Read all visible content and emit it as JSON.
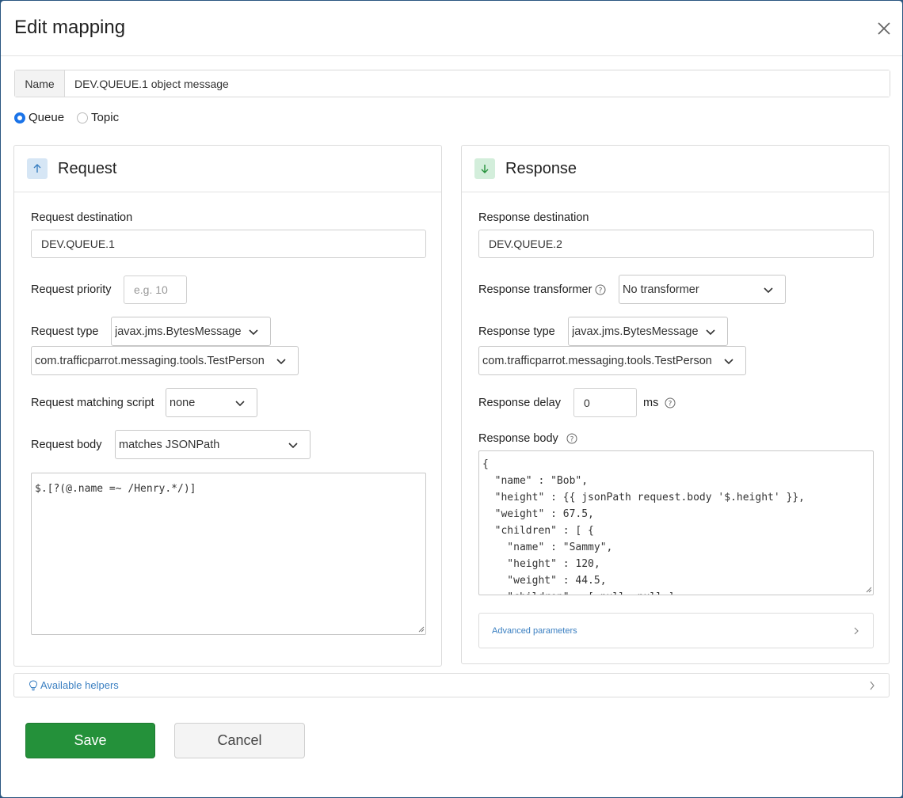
{
  "dialog": {
    "title": "Edit mapping"
  },
  "name": {
    "label": "Name",
    "value": "DEV.QUEUE.1 object message"
  },
  "destination_kind": {
    "queue_label": "Queue",
    "topic_label": "Topic",
    "selected": "Queue"
  },
  "request": {
    "title": "Request",
    "destination_label": "Request destination",
    "destination_value": "DEV.QUEUE.1",
    "priority_label": "Request priority",
    "priority_placeholder": "e.g. 10",
    "type_label": "Request type",
    "type_value": "javax.jms.BytesMessage",
    "class_value": "com.trafficparrot.messaging.tools.TestPerson",
    "matching_script_label": "Request matching script",
    "matching_script_value": "none",
    "body_label": "Request body",
    "body_matcher_value": "matches JSONPath",
    "body_value": "$.[?(@.name =~ /Henry.*/)]"
  },
  "response": {
    "title": "Response",
    "destination_label": "Response destination",
    "destination_value": "DEV.QUEUE.2",
    "transformer_label": "Response transformer",
    "transformer_value": "No transformer",
    "type_label": "Response type",
    "type_value": "javax.jms.BytesMessage",
    "class_value": "com.trafficparrot.messaging.tools.TestPerson",
    "delay_label": "Response delay",
    "delay_value": "0",
    "delay_unit": "ms",
    "body_label": "Response body",
    "body_value": "{\n  \"name\" : \"Bob\",\n  \"height\" : {{ jsonPath request.body '$.height' }},\n  \"weight\" : 67.5,\n  \"children\" : [ {\n    \"name\" : \"Sammy\",\n    \"height\" : 120,\n    \"weight\" : 44.5,\n    \"children\" : [ null, null ]",
    "advanced_label": "Advanced parameters"
  },
  "helpers": {
    "label": "Available helpers"
  },
  "buttons": {
    "save": "Save",
    "cancel": "Cancel"
  },
  "colors": {
    "save": "#24913a",
    "accent": "#1a73e8",
    "link": "#3a7fc1",
    "request_badge": "#d6e6f5",
    "response_badge": "#d3eedb"
  }
}
